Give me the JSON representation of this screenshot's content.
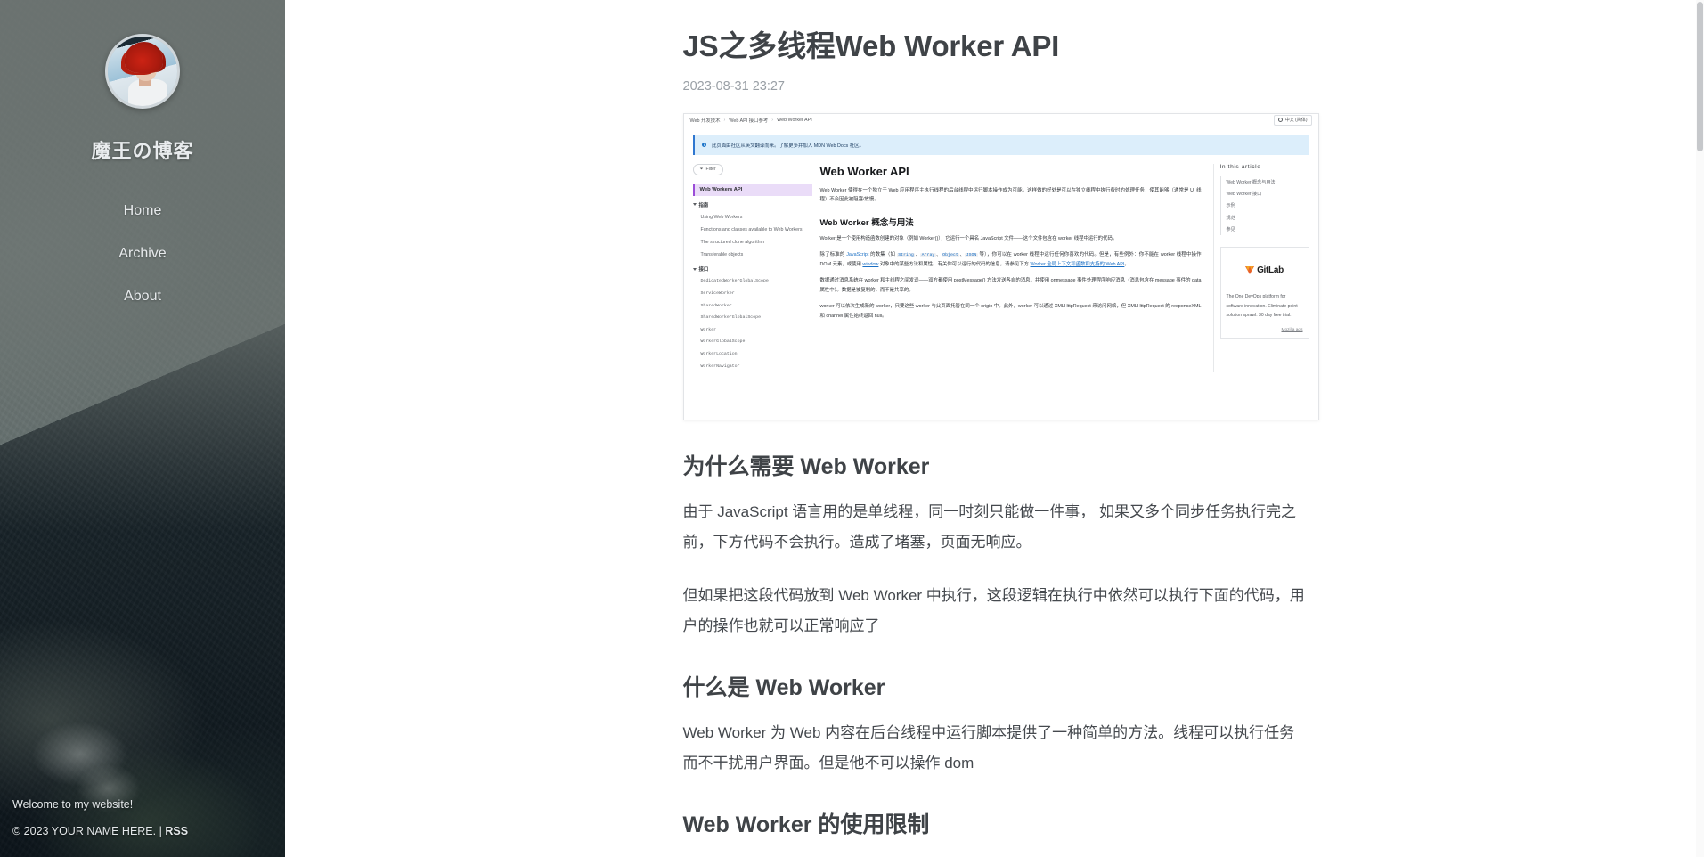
{
  "sidebar": {
    "avatar_alt": "avatar",
    "blog_title": "魔王の博客",
    "nav": [
      {
        "label": "Home"
      },
      {
        "label": "Archive"
      },
      {
        "label": "About"
      }
    ],
    "footer": {
      "welcome": "Welcome to my website!",
      "copyright": "© 2023 YOUR NAME HERE. |",
      "rss": "RSS"
    }
  },
  "post": {
    "title": "JS之多线程Web Worker API",
    "date": "2023-08-31 23:27",
    "sections": [
      {
        "heading": "为什么需要 Web Worker",
        "paragraphs": [
          "由于 JavaScript 语言用的是单线程，同一时刻只能做一件事， 如果又多个同步任务执行完之前，下方代码不会执行。造成了堵塞，页面无响应。",
          "但如果把这段代码放到 Web Worker 中执行，这段逻辑在执行中依然可以执行下面的代码，用户的操作也就可以正常响应了"
        ]
      },
      {
        "heading": "什么是 Web Worker",
        "paragraphs": [
          "Web Worker 为 Web 内容在后台线程中运行脚本提供了一种简单的方法。线程可以执行任务而不干扰用户界面。但是他不可以操作 dom"
        ]
      },
      {
        "heading": "Web Worker 的使用限制",
        "paragraphs": []
      }
    ]
  },
  "screenshot": {
    "breadcrumb": [
      "Web 开发技术",
      "Web API 接口参考",
      "Web Worker API"
    ],
    "breadcrumb_separator": "›",
    "lang_button": "中文 (简体)",
    "banner": "此页面由社区从英文翻译而来。了解更多并加入 MDN Web Docs 社区。",
    "filter_label": "Filter",
    "nav_current": "Web Workers API",
    "nav_groups": [
      {
        "label": "指南",
        "items": [
          {
            "text": "Using Web Workers",
            "mono": false
          },
          {
            "text": "Functions and classes available to Web Workers",
            "mono": false
          },
          {
            "text": "The structured clone algorithm",
            "mono": false
          },
          {
            "text": "Transferable objects",
            "mono": false
          }
        ]
      },
      {
        "label": "接口",
        "items": [
          {
            "text": "DedicatedWorkerGlobalScope",
            "mono": true
          },
          {
            "text": "ServiceWorker",
            "mono": true
          },
          {
            "text": "SharedWorker",
            "mono": true
          },
          {
            "text": "SharedWorkerGlobalScope",
            "mono": true
          },
          {
            "text": "Worker",
            "mono": true
          },
          {
            "text": "WorkerGlobalScope",
            "mono": true
          },
          {
            "text": "WorkerLocation",
            "mono": true
          },
          {
            "text": "WorkerNavigator",
            "mono": true
          }
        ]
      }
    ],
    "article_h1": "Web Worker API",
    "article_p1": "Web Worker 使得在一个独立于 Web 应用程序主执行线程的后台线程中运行脚本操作成为可能。这样做的好处是可以在独立线程中执行费时的处理任务，使其能够（通常是 UI 线程）不会因此被阻塞/放慢。",
    "article_h2": "Web Worker 概念与用法",
    "article_p2": "Worker 是一个使用构造函数创建的对象（例如 Worker()），它运行一个具名 JavaScript 文件——这个文件包含在 worker 线程中运行的代码。",
    "article_p3_parts": {
      "a": "除了标准的 ",
      "js": "JavaScript",
      "b": " 的数集（如 ",
      "c1": "String",
      "c2": "Array",
      "c3": "Object",
      "c4": "JSON",
      "d": " 等），你可以在 worker 线程中运行任何你喜欢的代码。但是，有些例外：你不能在 worker 线程中操作 DOM 元素，或使用 ",
      "e": "window",
      "f": " 对象中的某些方法和属性。有关你可以运行的代码的信息，请参见下方 ",
      "g": "Worker 全局上下文和函数和支持的 Web API",
      "h": "。"
    },
    "article_p4": "数据通过消息系统在 worker 和主线程之间发送——双方都使用 postMessage() 方法发送各自的消息，并使用 onmessage 事件处理程序响应消息（消息包含在 message 事件的 data 属性中）。数据是被复制的，而不是共享的。",
    "article_p5": "worker 可以依次生成新的 worker，只要这些 worker 与父页面托管在同一个 origin 中。此外，worker 可以通过 XMLHttpRequest 来访问网络，但 XMLHttpRequest 的 responseXML 和 channel 属性始终返回 null。",
    "in_this_article_title": "In this article",
    "in_this_article": [
      "Web Worker 概念与用法",
      "Web Worker 接口",
      "示例",
      "规范",
      "参见"
    ],
    "ad": {
      "brand": "GitLab",
      "text": "The One DevOps platform for software innovation. Eliminate point solution sprawl. 30 day free trial.",
      "link": "Mozilla ads"
    }
  },
  "colors": {
    "accent_purple": "#9b4dd8",
    "banner_blue": "#2f77d0",
    "link_blue": "#1a6fc4",
    "text_dark": "#3f4347"
  }
}
